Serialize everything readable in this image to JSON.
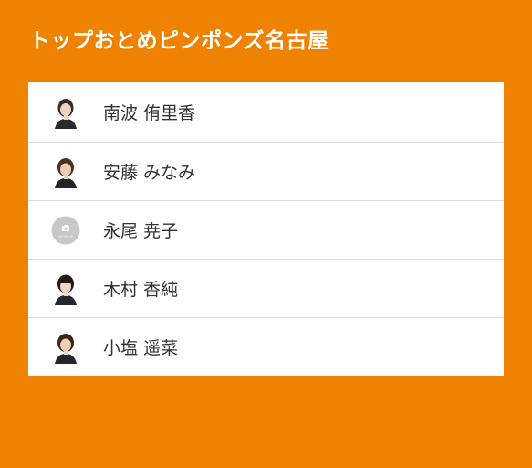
{
  "team": {
    "name": "トップおとめピンポンズ名古屋"
  },
  "players": [
    {
      "name": "南波 侑里香",
      "photo": "player-photo"
    },
    {
      "name": "安藤 みなみ",
      "photo": "player-photo"
    },
    {
      "name": "永尾 尭子",
      "photo": "no-image-placeholder"
    },
    {
      "name": "木村 香純",
      "photo": "player-photo"
    },
    {
      "name": "小塩 遥菜",
      "photo": "player-photo"
    }
  ],
  "placeholder_label": "NO IMAGE",
  "colors": {
    "background": "#ef8200",
    "card": "#ffffff",
    "divider": "#dcdcdc",
    "text": "#333333",
    "placeholder": "#c8c8c8"
  }
}
